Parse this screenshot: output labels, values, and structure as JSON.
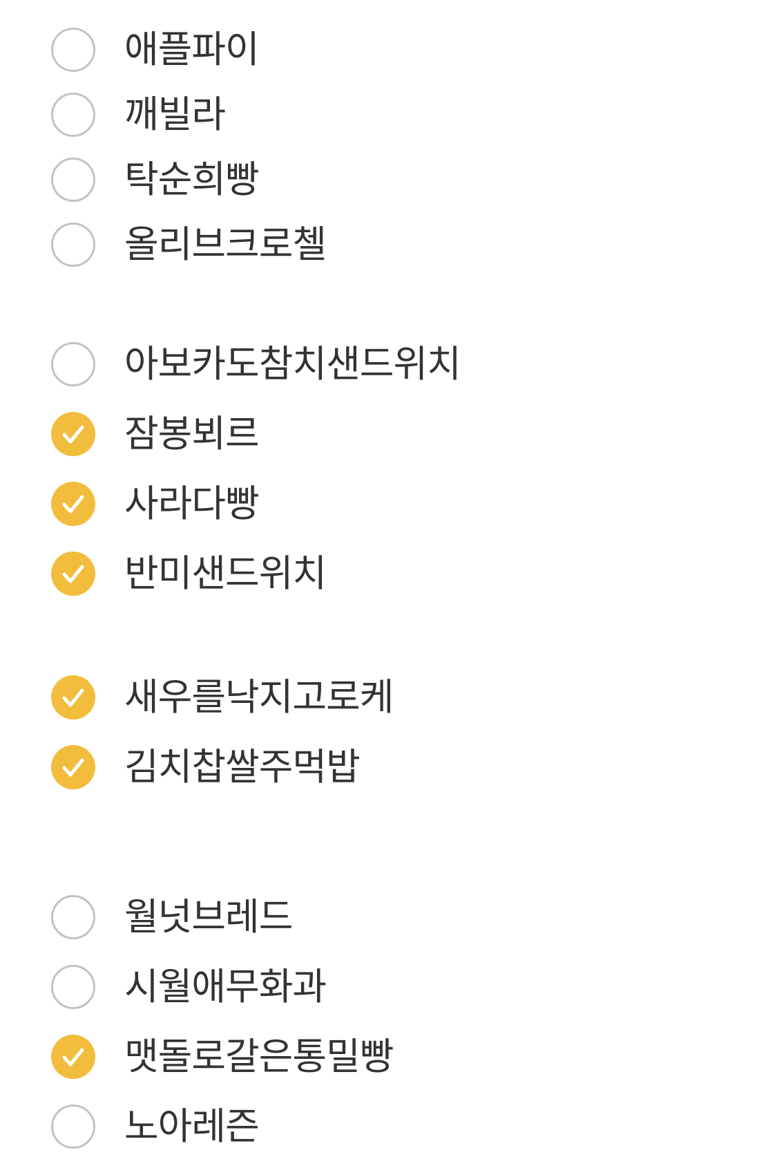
{
  "colors": {
    "checked_fill": "#f2bd3c",
    "unchecked_border": "#c2c2c2",
    "text": "#333333",
    "check_mark": "#ffffff"
  },
  "icons": {
    "checked": "check-icon",
    "unchecked": "empty-circle-icon"
  },
  "groups": [
    {
      "items": [
        {
          "label": "애플파이",
          "checked": false
        },
        {
          "label": "깨빌라",
          "checked": false
        },
        {
          "label": "탁순희빵",
          "checked": false
        },
        {
          "label": "올리브크로첼",
          "checked": false
        }
      ]
    },
    {
      "items": [
        {
          "label": "아보카도참치샌드위치",
          "checked": false
        },
        {
          "label": "잠봉뵈르",
          "checked": true
        },
        {
          "label": "사라다빵",
          "checked": true
        },
        {
          "label": "반미샌드위치",
          "checked": true
        }
      ]
    },
    {
      "items": [
        {
          "label": "새우를낙지고로케",
          "checked": true
        },
        {
          "label": "김치찹쌀주먹밥",
          "checked": true
        }
      ]
    },
    {
      "items": [
        {
          "label": "월넛브레드",
          "checked": false
        },
        {
          "label": "시월애무화과",
          "checked": false
        },
        {
          "label": "맷돌로갈은통밀빵",
          "checked": true
        },
        {
          "label": "노아레즌",
          "checked": false
        }
      ]
    }
  ]
}
